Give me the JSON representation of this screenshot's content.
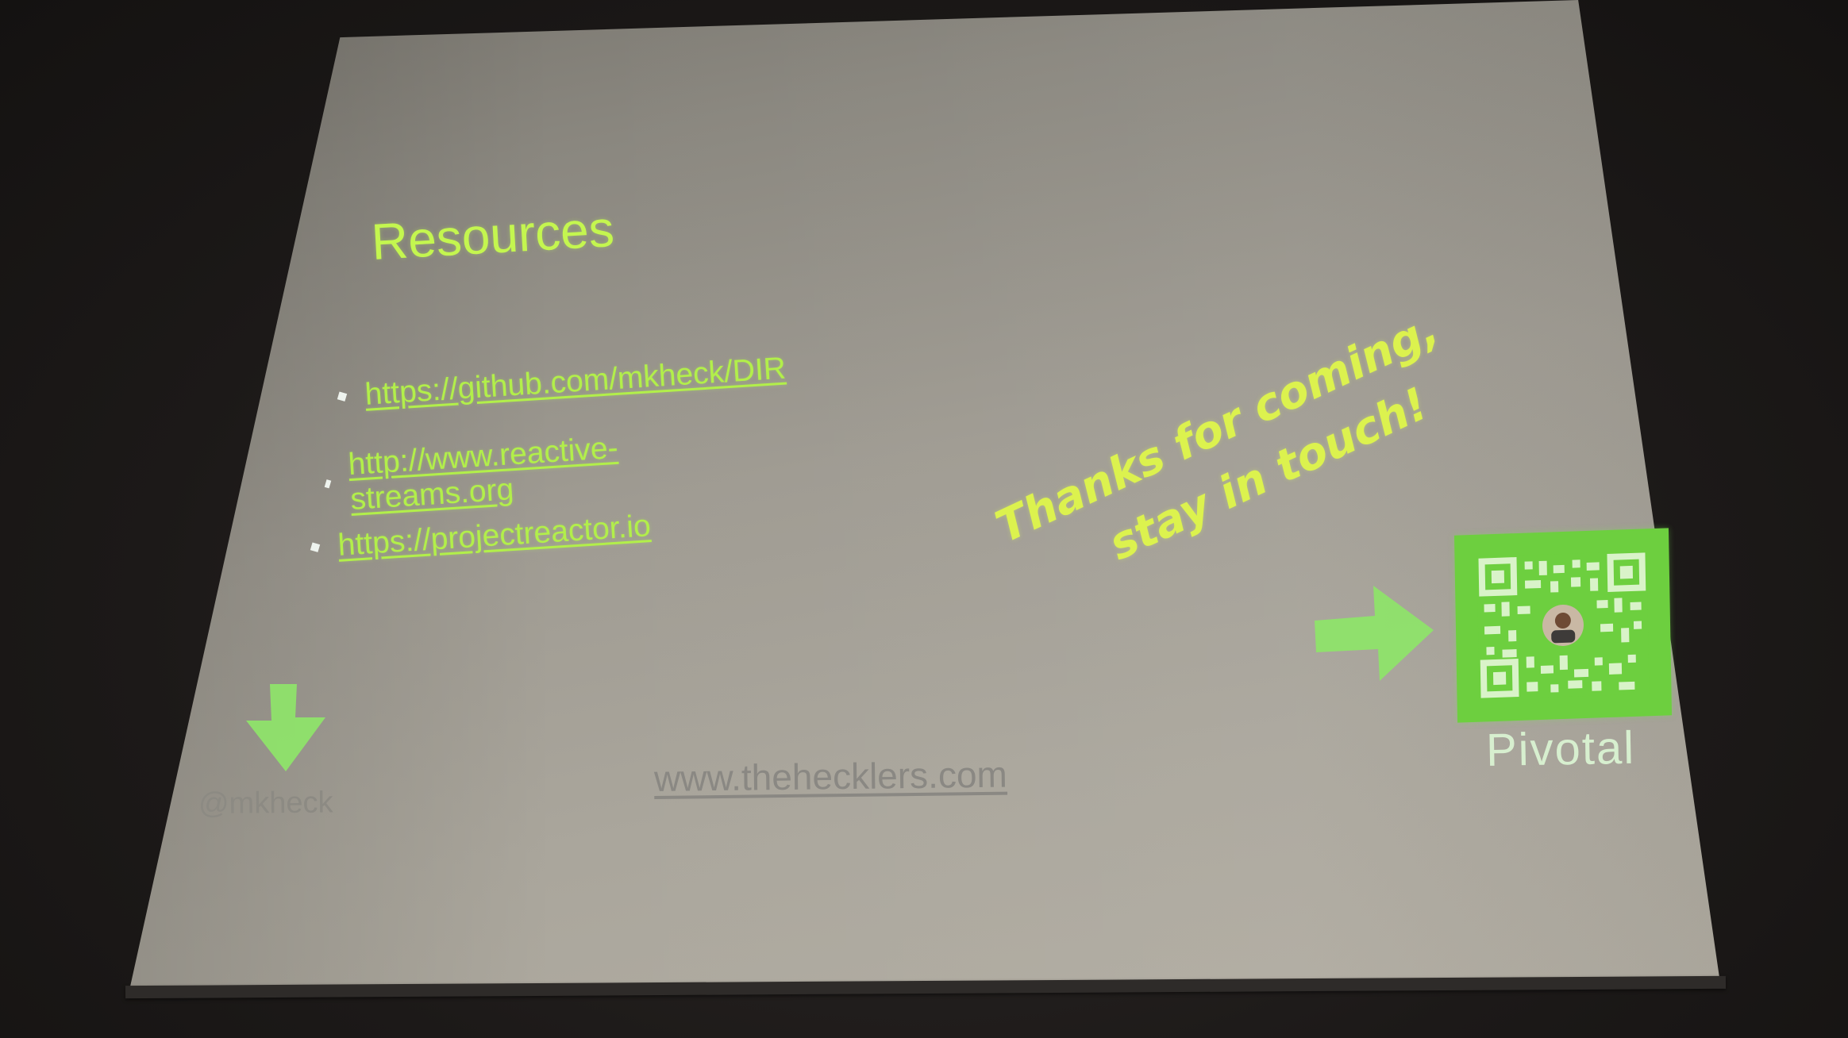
{
  "slide": {
    "title": "Resources",
    "links": [
      "https://github.com/mkheck/DIR",
      "http://www.reactive-streams.org",
      "https://projectreactor.io"
    ],
    "thanks_line1": "Thanks for coming,",
    "thanks_line2": "stay in touch!",
    "brand": "Pivotal",
    "handle": "@mkheck",
    "website": "www.thehecklers.com"
  },
  "colors": {
    "accent_green": "#b8f24a",
    "qr_green": "#6dcf3f",
    "screen_gray": "#9f9b92"
  },
  "icons": [
    "arrow-down-icon",
    "arrow-right-icon",
    "qr-code-icon"
  ]
}
